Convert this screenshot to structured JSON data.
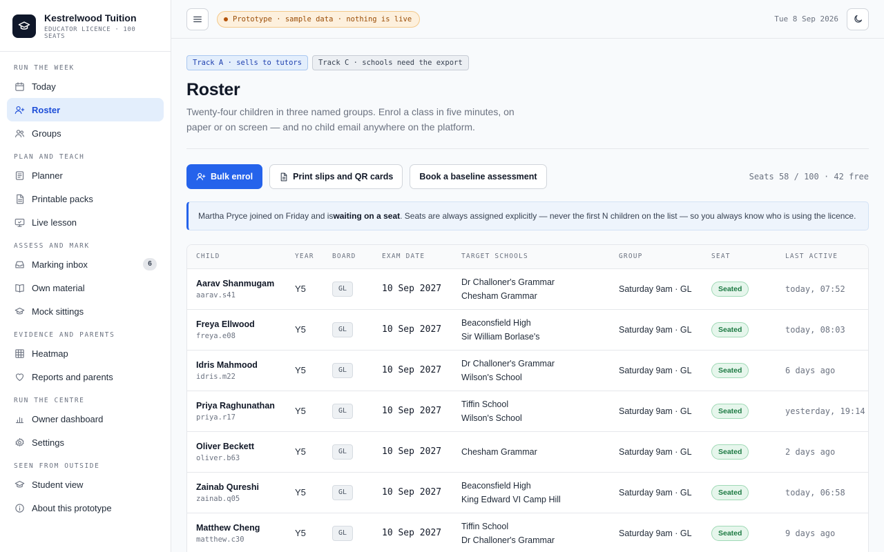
{
  "brand": {
    "title": "Kestrelwood Tuition",
    "subtitle": "EDUCATOR LICENCE · 100 SEATS"
  },
  "nav": {
    "sections": [
      {
        "title": "RUN THE WEEK",
        "items": [
          {
            "label": "Today",
            "icon": "calendar-icon"
          },
          {
            "label": "Roster",
            "icon": "user-plus-icon",
            "active": true
          },
          {
            "label": "Groups",
            "icon": "users-icon"
          }
        ]
      },
      {
        "title": "PLAN AND TEACH",
        "items": [
          {
            "label": "Planner",
            "icon": "planner-icon"
          },
          {
            "label": "Printable packs",
            "icon": "document-icon"
          },
          {
            "label": "Live lesson",
            "icon": "monitor-icon"
          }
        ]
      },
      {
        "title": "ASSESS AND MARK",
        "items": [
          {
            "label": "Marking inbox",
            "icon": "inbox-icon",
            "badge": "6"
          },
          {
            "label": "Own material",
            "icon": "book-icon"
          },
          {
            "label": "Mock sittings",
            "icon": "graduation-cap-icon"
          }
        ]
      },
      {
        "title": "EVIDENCE AND PARENTS",
        "items": [
          {
            "label": "Heatmap",
            "icon": "grid-icon"
          },
          {
            "label": "Reports and parents",
            "icon": "heart-icon"
          }
        ]
      },
      {
        "title": "RUN THE CENTRE",
        "items": [
          {
            "label": "Owner dashboard",
            "icon": "bar-chart-icon"
          },
          {
            "label": "Settings",
            "icon": "gear-icon"
          }
        ]
      },
      {
        "title": "SEEN FROM OUTSIDE",
        "items": [
          {
            "label": "Student view",
            "icon": "graduation-cap-icon"
          },
          {
            "label": "About this prototype",
            "icon": "info-icon"
          }
        ]
      }
    ]
  },
  "topbar": {
    "prototype_label": "Prototype · sample data · nothing is live",
    "date": "Tue 8 Sep 2026"
  },
  "tracks": {
    "a": "Track A · sells to tutors",
    "c": "Track C · schools need the export"
  },
  "page": {
    "title": "Roster",
    "description": "Twenty-four children in three named groups. Enrol a class in five minutes, on paper or on screen — and no child email anywhere on the platform."
  },
  "actions": {
    "bulk_enrol": "Bulk enrol",
    "print_slips": "Print slips and QR cards",
    "book_baseline": "Book a baseline assessment",
    "seats_info": "Seats 58 / 100 · 42 free"
  },
  "notice": {
    "before": "Martha Pryce joined on Friday and is ",
    "bold": "waiting on a seat",
    "after": ". Seats are always assigned explicitly — never the first N children on the list — so you always know who is using the licence."
  },
  "table": {
    "headers": [
      "CHILD",
      "YEAR",
      "BOARD",
      "EXAM DATE",
      "TARGET SCHOOLS",
      "GROUP",
      "SEAT",
      "LAST ACTIVE"
    ],
    "rows": [
      {
        "name": "Aarav Shanmugam",
        "id": "aarav.s41",
        "year": "Y5",
        "board": "GL",
        "exam": "10 Sep 2027",
        "schools": [
          "Dr Challoner's Grammar",
          "Chesham Grammar"
        ],
        "group": "Saturday 9am · GL",
        "seat": "Seated",
        "last": "today, 07:52"
      },
      {
        "name": "Freya Ellwood",
        "id": "freya.e08",
        "year": "Y5",
        "board": "GL",
        "exam": "10 Sep 2027",
        "schools": [
          "Beaconsfield High",
          "Sir William Borlase's"
        ],
        "group": "Saturday 9am · GL",
        "seat": "Seated",
        "last": "today, 08:03"
      },
      {
        "name": "Idris Mahmood",
        "id": "idris.m22",
        "year": "Y5",
        "board": "GL",
        "exam": "10 Sep 2027",
        "schools": [
          "Dr Challoner's Grammar",
          "Wilson's School"
        ],
        "group": "Saturday 9am · GL",
        "seat": "Seated",
        "last": "6 days ago"
      },
      {
        "name": "Priya Raghunathan",
        "id": "priya.r17",
        "year": "Y5",
        "board": "GL",
        "exam": "10 Sep 2027",
        "schools": [
          "Tiffin School",
          "Wilson's School"
        ],
        "group": "Saturday 9am · GL",
        "seat": "Seated",
        "last": "yesterday, 19:14"
      },
      {
        "name": "Oliver Beckett",
        "id": "oliver.b63",
        "year": "Y5",
        "board": "GL",
        "exam": "10 Sep 2027",
        "schools": [
          "Chesham Grammar"
        ],
        "group": "Saturday 9am · GL",
        "seat": "Seated",
        "last": "2 days ago"
      },
      {
        "name": "Zainab Qureshi",
        "id": "zainab.q05",
        "year": "Y5",
        "board": "GL",
        "exam": "10 Sep 2027",
        "schools": [
          "Beaconsfield High",
          "King Edward VI Camp Hill"
        ],
        "group": "Saturday 9am · GL",
        "seat": "Seated",
        "last": "today, 06:58"
      },
      {
        "name": "Matthew Cheng",
        "id": "matthew.c30",
        "year": "Y5",
        "board": "GL",
        "exam": "10 Sep 2027",
        "schools": [
          "Tiffin School",
          "Dr Challoner's Grammar"
        ],
        "group": "Saturday 9am · GL",
        "seat": "Seated",
        "last": "9 days ago"
      }
    ]
  },
  "colors": {
    "accent": "#2563eb",
    "seated": "#1d7a43",
    "prototype": "#9a4d07"
  }
}
